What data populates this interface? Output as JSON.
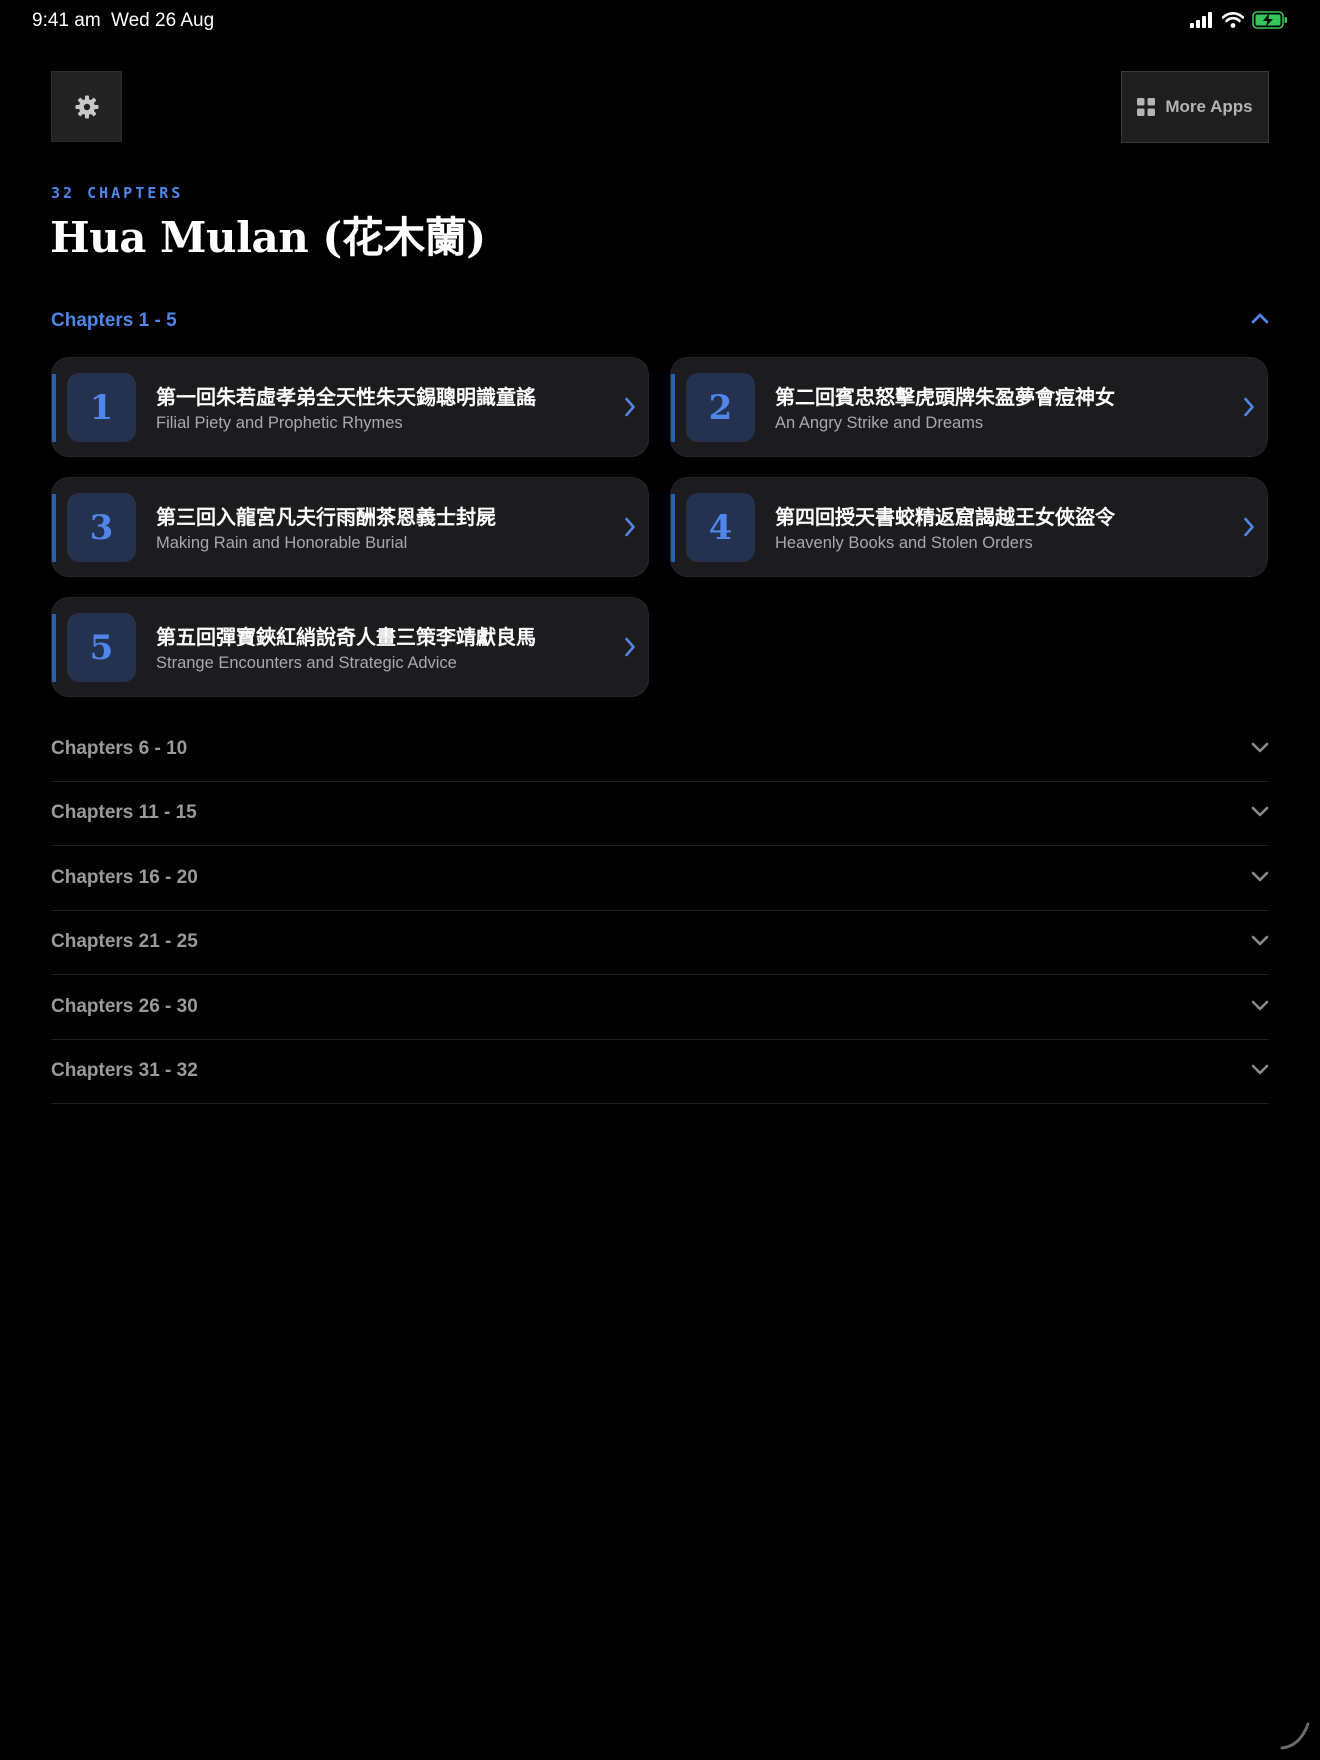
{
  "status_bar": {
    "time": "9:41 am",
    "date": "Wed 26 Aug",
    "battery_color": "#34c759"
  },
  "toolbar": {
    "settings_icon": "gear-icon",
    "more_apps_label": "More Apps",
    "more_apps_icon": "grid-icon"
  },
  "header": {
    "chapter_count": "32 CHAPTERS",
    "title": "Hua Mulan (花木蘭)"
  },
  "colors": {
    "accent": "#4f86e8",
    "card_bg": "#1c1c1e",
    "background": "#000000"
  },
  "expanded_section": {
    "label": "Chapters 1 - 5",
    "chapters": [
      {
        "number": "1",
        "title_zh": "第一回朱若虛孝弟全天性朱天錫聰明識童謠",
        "title_en": "Filial Piety and Prophetic Rhymes"
      },
      {
        "number": "2",
        "title_zh": "第二回賓忠怒擊虎頭牌朱盈夢會痘神女",
        "title_en": "An Angry Strike and Dreams"
      },
      {
        "number": "3",
        "title_zh": "第三回入龍宮凡夫行雨酬茶恩義士封屍",
        "title_en": "Making Rain and Honorable Burial"
      },
      {
        "number": "4",
        "title_zh": "第四回授天書蛟精返窟謁越王女俠盜令",
        "title_en": "Heavenly Books and Stolen Orders"
      },
      {
        "number": "5",
        "title_zh": "第五回彈寶鋏紅綃說奇人畫三策李靖獻良馬",
        "title_en": "Strange Encounters and Strategic Advice"
      }
    ]
  },
  "collapsed_sections": [
    {
      "label": "Chapters 6 - 10"
    },
    {
      "label": "Chapters 11 - 15"
    },
    {
      "label": "Chapters 16 - 20"
    },
    {
      "label": "Chapters 21 - 25"
    },
    {
      "label": "Chapters 26 - 30"
    },
    {
      "label": "Chapters 31 - 32"
    }
  ]
}
